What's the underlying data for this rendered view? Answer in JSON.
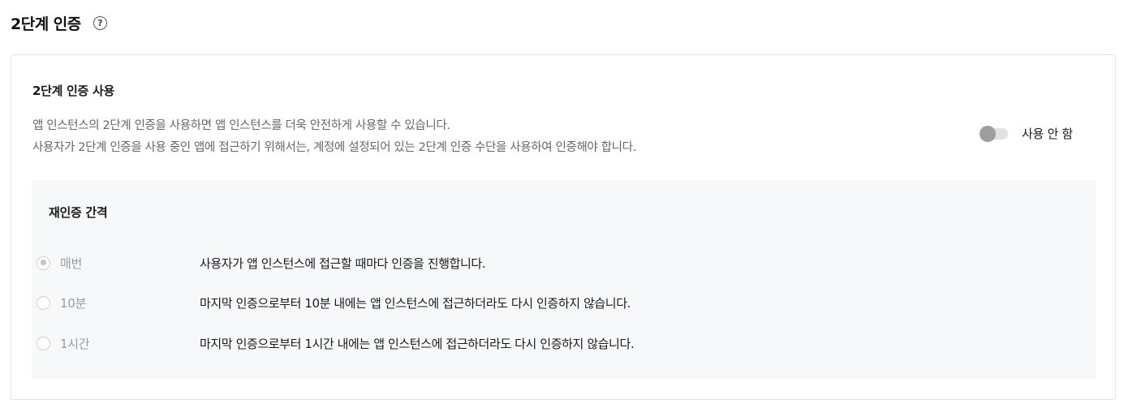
{
  "header": {
    "title": "2단계 인증",
    "help_icon": "question-circle-icon",
    "help_glyph": "?"
  },
  "two_factor": {
    "section_title": "2단계 인증 사용",
    "description_line1": "앱 인스턴스의 2단계 인증을 사용하면 앱 인스턴스를 더욱 안전하게 사용할 수 있습니다.",
    "description_line2": "사용자가 2단계 인증을 사용 중인 앱에 접근하기 위해서는, 계정에 설정되어 있는 2단계 인증 수단을 사용하여 인증해야 합니다.",
    "toggle": {
      "enabled": false,
      "label": "사용 안 함"
    }
  },
  "reauth_interval": {
    "title": "재인증 간격",
    "disabled": true,
    "options": [
      {
        "label": "매번",
        "description": "사용자가 앱 인스턴스에 접근할 때마다 인증을 진행합니다.",
        "selected": true
      },
      {
        "label": "10분",
        "description": "마지막 인증으로부터 10분 내에는 앱 인스턴스에 접근하더라도 다시 인증하지 않습니다.",
        "selected": false
      },
      {
        "label": "1시간",
        "description": "마지막 인증으로부터 1시간 내에는 앱 인스턴스에 접근하더라도 다시 인증하지 않습니다.",
        "selected": false
      }
    ]
  },
  "colors": {
    "toggle_off_knob": "#9e9e9e",
    "toggle_off_track": "#e2e2e2",
    "panel_background": "#f7f8fa",
    "disabled_text": "#9a9a9a"
  }
}
